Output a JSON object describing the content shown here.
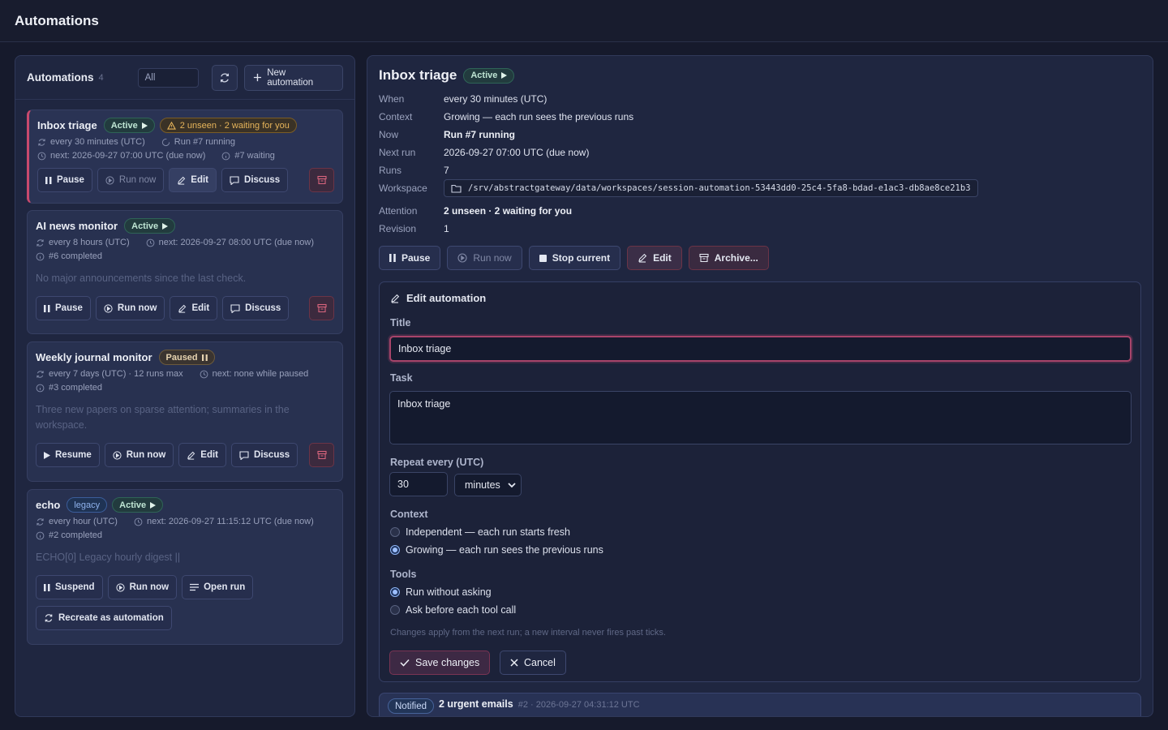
{
  "app": {
    "title": "Automations"
  },
  "list": {
    "title": "Automations",
    "count": "4",
    "filter_value": "All",
    "new_button": "New automation",
    "cards": [
      {
        "title": "Inbox triage",
        "status": "Active",
        "attention": "2 unseen · 2 waiting for you",
        "meta1a": "every 30 minutes (UTC)",
        "meta1b": "Run #7 running",
        "meta2a": "next: 2026-09-27 07:00 UTC (due now)",
        "meta2b": "#7 waiting",
        "buttons": [
          "Pause",
          "Run now",
          "Edit",
          "Discuss"
        ]
      },
      {
        "title": "AI news monitor",
        "status": "Active",
        "meta1a": "every 8 hours (UTC)",
        "meta1b": "next: 2026-09-27 08:00 UTC (due now)",
        "meta2a": "#6 completed",
        "desc": "No major announcements since the last check.",
        "buttons": [
          "Pause",
          "Run now",
          "Edit",
          "Discuss"
        ]
      },
      {
        "title": "Weekly journal monitor",
        "status": "Paused",
        "meta1a": "every 7 days (UTC) · 12 runs max",
        "meta1b": "next: none while paused",
        "meta2a": "#3 completed",
        "desc": "Three new papers on sparse attention; summaries in the workspace.",
        "buttons": [
          "Resume",
          "Run now",
          "Edit",
          "Discuss"
        ]
      },
      {
        "title": "echo",
        "tag": "legacy",
        "status": "Active",
        "meta1a": "every hour (UTC)",
        "meta1b": "next: 2026-09-27 11:15:12 UTC (due now)",
        "meta2a": "#2 completed",
        "desc": "ECHO[0] Legacy hourly digest ||",
        "buttons": [
          "Suspend",
          "Run now",
          "Open run"
        ],
        "extra_button": "Recreate as automation"
      }
    ]
  },
  "detail": {
    "title": "Inbox triage",
    "status": "Active",
    "fields": [
      {
        "k": "When",
        "v": "every 30 minutes (UTC)"
      },
      {
        "k": "Context",
        "v": "Growing — each run sees the previous runs"
      },
      {
        "k": "Now",
        "v": "Run #7 running"
      },
      {
        "k": "Next run",
        "v": "2026-09-27 07:00 UTC (due now)"
      },
      {
        "k": "Runs",
        "v": "7"
      },
      {
        "k": "Workspace",
        "v": "/srv/abstractgateway/data/workspaces/session-automation-53443dd0-25c4-5fa8-bdad-e1ac3-db8ae8ce21b3"
      },
      {
        "k": "Attention",
        "v": "2 unseen · 2 waiting for you"
      },
      {
        "k": "Revision",
        "v": "1"
      }
    ],
    "actions": [
      "Pause",
      "Run now",
      "Stop current",
      "Edit",
      "Archive..."
    ]
  },
  "edit": {
    "heading": "Edit automation",
    "title_label": "Title",
    "title_value": "Inbox triage",
    "task_label": "Task",
    "task_value": "Inbox triage",
    "repeat_label": "Repeat every (UTC)",
    "repeat_value": "30",
    "repeat_unit": "minutes",
    "context_label": "Context",
    "context_options": [
      "Independent — each run starts fresh",
      "Growing — each run sees the previous runs"
    ],
    "tools_label": "Tools",
    "tools_options": [
      "Run without asking",
      "Ask before each tool call"
    ],
    "hint": "Changes apply from the next run; a new interval never fires past ticks.",
    "save": "Save changes",
    "cancel": "Cancel"
  },
  "notification": {
    "badge": "Notified",
    "title": "2 urgent emails",
    "meta": "#2 · 2026-09-27 04:31:12 UTC"
  },
  "colors": {
    "accent": "#c9496d",
    "active": "#2f6457",
    "warning": "#e6b45a",
    "link": "#8fb2ec"
  }
}
